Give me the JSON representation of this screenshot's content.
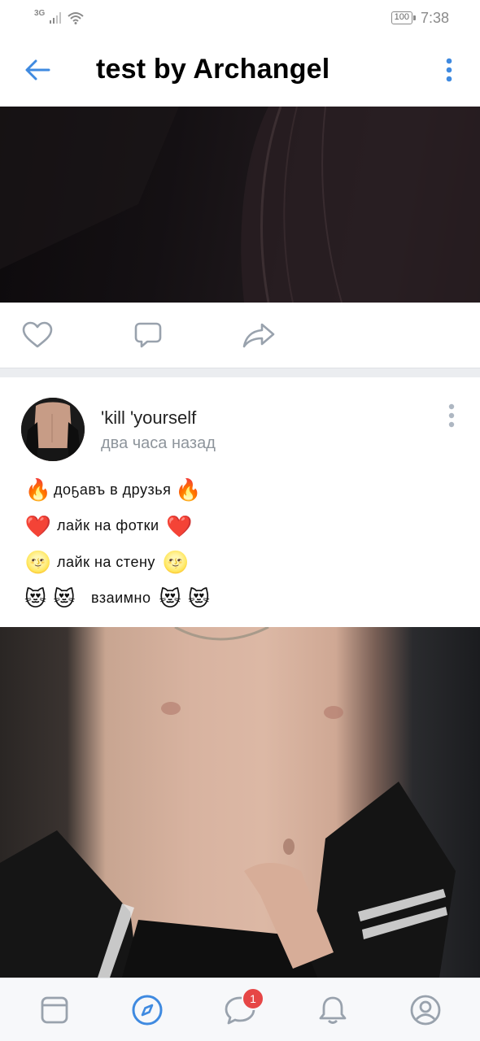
{
  "status_bar": {
    "network": "3G",
    "battery": "100",
    "time": "7:38"
  },
  "header": {
    "title": "test by Archangel"
  },
  "post": {
    "author": "'kill 'yourself",
    "time": "два часа назад",
    "lines": [
      {
        "prefix": "🔥",
        "text": "доҕавъ в друзья",
        "suffix": "🔥"
      },
      {
        "prefix": "❤️",
        "text": "лайк на фотки",
        "suffix": "❤️"
      },
      {
        "prefix": "🌝",
        "text": "лайк на стену",
        "suffix": "🌝"
      },
      {
        "prefix": "😻 😻",
        "text": "взаимно",
        "suffix": "😻 😻"
      }
    ]
  },
  "bottom_nav": {
    "messages_badge": "1"
  },
  "colors": {
    "accent": "#3f8ae0",
    "icon_gray": "#99a2ad",
    "badge": "#e64646"
  }
}
